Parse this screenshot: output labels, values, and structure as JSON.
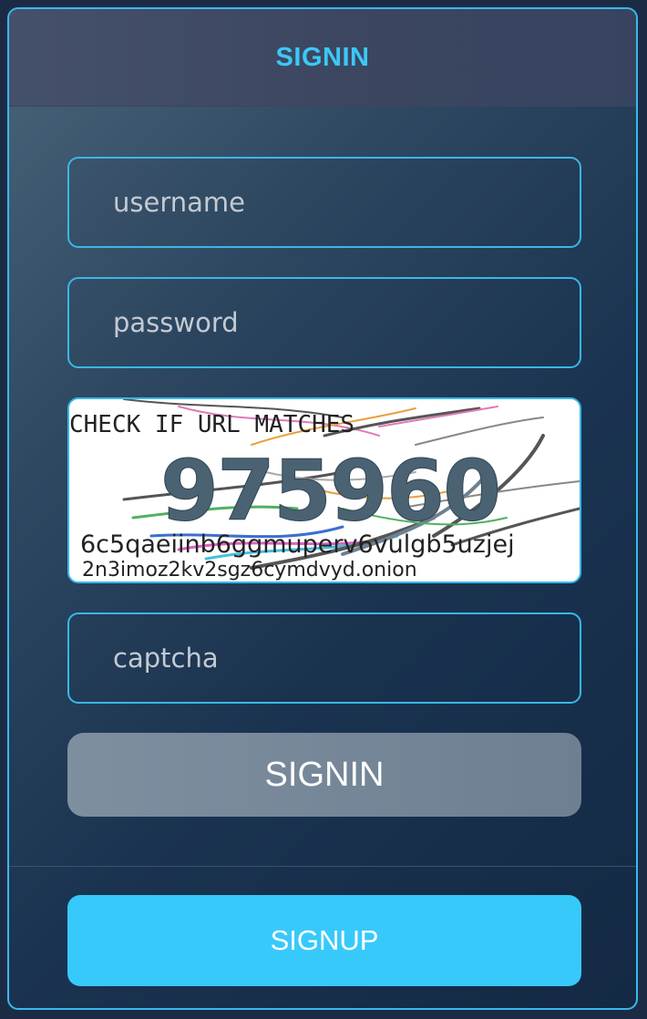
{
  "header": {
    "title": "SIGNIN"
  },
  "form": {
    "username_placeholder": "username",
    "password_placeholder": "password",
    "captcha_placeholder": "captcha"
  },
  "captcha_image": {
    "top_text": "CHECK IF URL MATCHES",
    "code": "975960",
    "url_line1": "6c5qaeiinb6ggmuperv6vulgb5uzjej",
    "url_line2": "2n3imoz2kv2sgz6cymdvyd.onion"
  },
  "buttons": {
    "signin_label": "SIGNIN",
    "signup_label": "SIGNUP"
  },
  "colors": {
    "accent": "#3ab8ec",
    "title": "#3cc8f5",
    "signin_button": "#75869a",
    "signup_button": "#38c9fb"
  }
}
